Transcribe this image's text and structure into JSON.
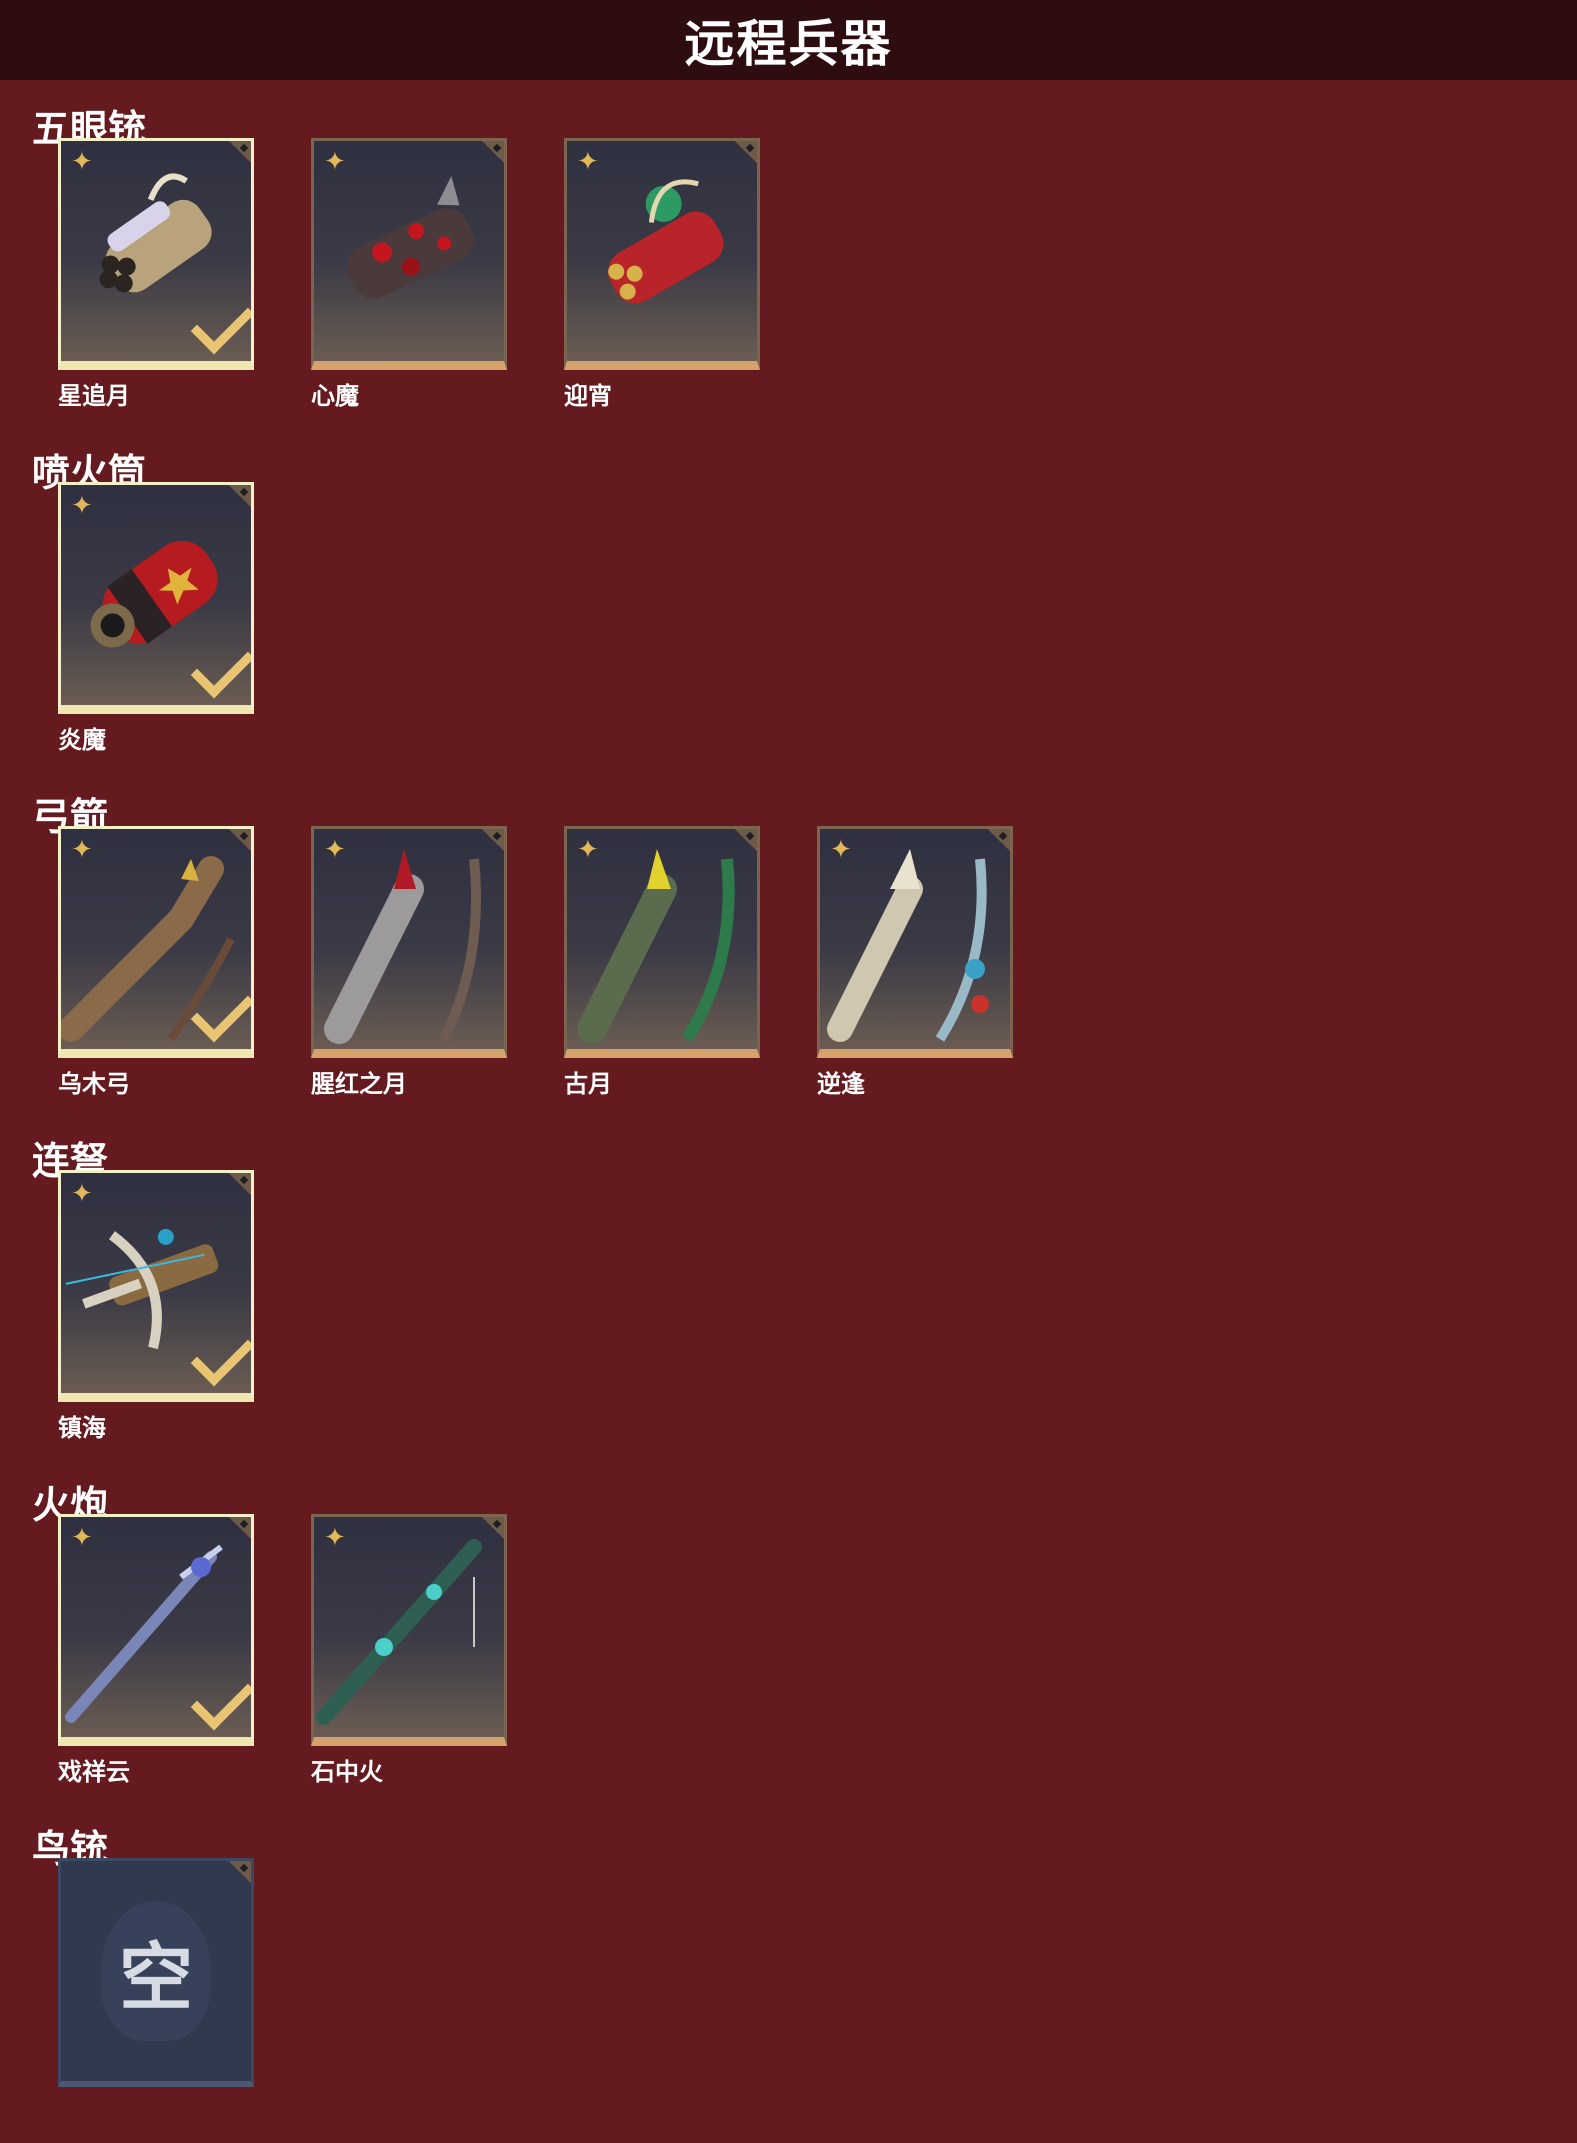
{
  "header": {
    "title": "远程兵器"
  },
  "sections": [
    {
      "title": "五眼铳",
      "items": [
        {
          "label": "星追月",
          "equipped": true
        },
        {
          "label": "心魔",
          "equipped": false
        },
        {
          "label": "迎宵",
          "equipped": false
        }
      ]
    },
    {
      "title": "喷火筒",
      "items": [
        {
          "label": "炎魔",
          "equipped": true
        }
      ]
    },
    {
      "title": "弓箭",
      "items": [
        {
          "label": "乌木弓",
          "equipped": true
        },
        {
          "label": "腥红之月",
          "equipped": false
        },
        {
          "label": "古月",
          "equipped": false
        },
        {
          "label": "逆逢",
          "equipped": false
        }
      ]
    },
    {
      "title": "连弩",
      "items": [
        {
          "label": "镇海",
          "equipped": true
        }
      ]
    },
    {
      "title": "火炮",
      "items": [
        {
          "label": "戏祥云",
          "equipped": true
        },
        {
          "label": "石中火",
          "equipped": false
        }
      ]
    },
    {
      "title": "鸟铳",
      "items": [
        {
          "empty_text": "空"
        }
      ]
    }
  ],
  "icons": {
    "rarity": "star-icon",
    "equipped": "checkmark-icon",
    "corner": "corner-tag-icon"
  },
  "colors": {
    "background": "#641a1e",
    "header": "#2d0d10",
    "card_border": "#d4a26a",
    "equipped_border": "#f3efc9",
    "check": "#e8c473"
  }
}
